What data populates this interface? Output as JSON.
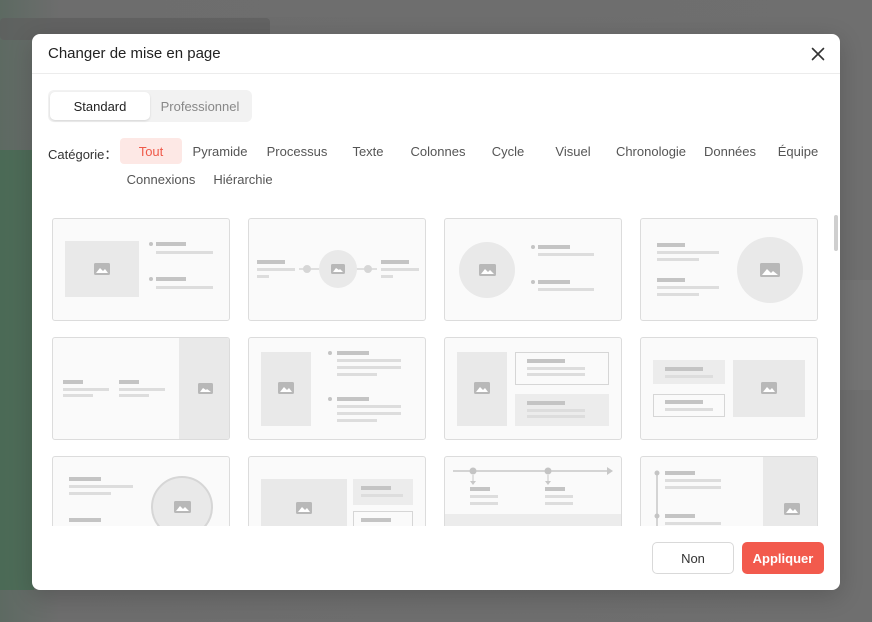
{
  "modal": {
    "title": "Changer de mise en page"
  },
  "tabs": [
    {
      "label": "Standard",
      "active": true
    },
    {
      "label": "Professionnel",
      "active": false
    }
  ],
  "category": {
    "label": "Catégorie：",
    "items": [
      {
        "label": "Tout",
        "active": true
      },
      {
        "label": "Pyramide"
      },
      {
        "label": "Processus"
      },
      {
        "label": "Texte"
      },
      {
        "label": "Colonnes"
      },
      {
        "label": "Cycle"
      },
      {
        "label": "Visuel"
      },
      {
        "label": "Chronologie"
      },
      {
        "label": "Données"
      },
      {
        "label": "Équipe"
      },
      {
        "label": "Connexions"
      },
      {
        "label": "Hiérarchie"
      }
    ]
  },
  "layouts": [
    {
      "id": "image-left-bullets"
    },
    {
      "id": "center-image-flow"
    },
    {
      "id": "circle-image-left-bullets"
    },
    {
      "id": "bullets-circle-image-right"
    },
    {
      "id": "two-columns-image-right"
    },
    {
      "id": "image-left-two-blocks"
    },
    {
      "id": "image-left-boxed-items"
    },
    {
      "id": "boxes-with-image"
    },
    {
      "id": "text-circle-image"
    },
    {
      "id": "image-with-side-boxes"
    },
    {
      "id": "timeline-horizontal"
    },
    {
      "id": "timeline-vertical-image"
    }
  ],
  "footer": {
    "cancel_label": "Non",
    "apply_label": "Appliquer"
  },
  "colors": {
    "accent": "#f25a4d",
    "accent_bg": "#fde8e5",
    "placeholder": "#e6e6e6",
    "line": "#d0d0d0"
  }
}
